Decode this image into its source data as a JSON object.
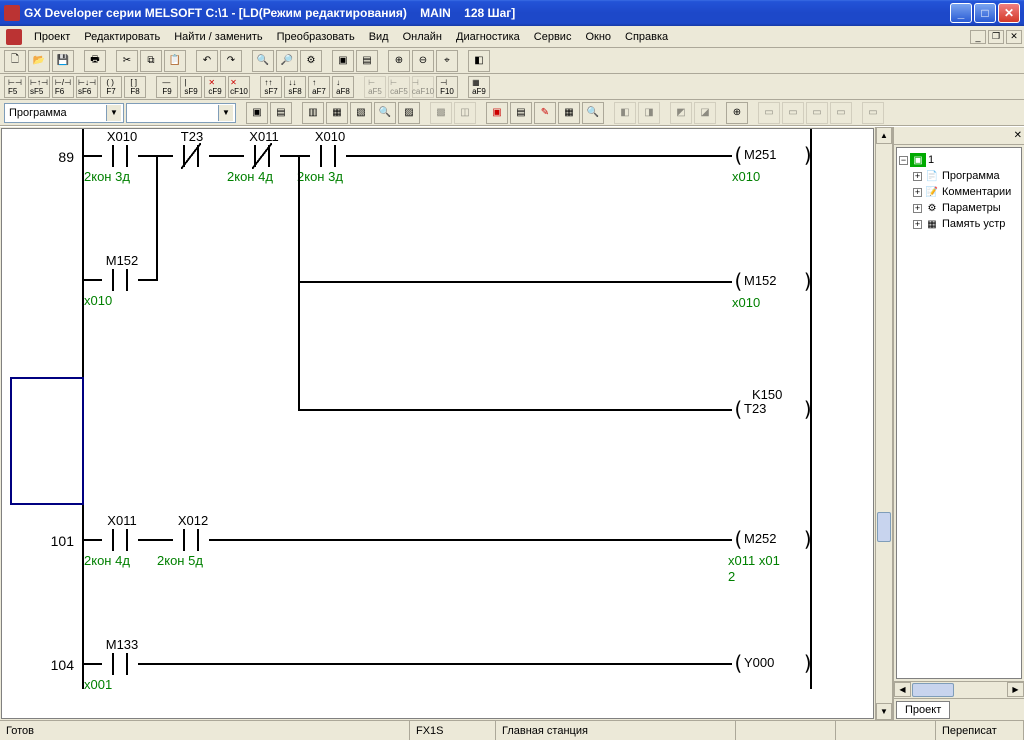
{
  "window": {
    "title": "GX Developer серии MELSOFT C:\\1 - [LD(Режим редактирования)    MAIN    128 Шаг]"
  },
  "menu": {
    "project": "Проект",
    "edit": "Редактировать",
    "find": "Найти / заменить",
    "convert": "Преобразовать",
    "view": "Вид",
    "online": "Онлайн",
    "diagnostics": "Диагностика",
    "service": "Сервис",
    "window_m": "Окно",
    "help": "Справка"
  },
  "shortcut_bar": {
    "f5": "F5",
    "sf5": "sF5",
    "f6": "F6",
    "sf6": "sF6",
    "f7": "F7",
    "f8": "F8",
    "f9": "F9",
    "sf9": "sF9",
    "cf9": "cF9",
    "cf10": "cF10",
    "sf7": "sF7",
    "sf8": "sF8",
    "af7": "aF7",
    "af8": "aF8",
    "af5": "aF5",
    "caf5": "caF5",
    "caf10": "caF10",
    "f10": "F10",
    "af9": "aF9"
  },
  "combo": {
    "program": "Программа"
  },
  "ladder": {
    "step89": "89",
    "step101": "101",
    "step104": "104",
    "X010": "X010",
    "T23": "T23",
    "X011": "X011",
    "X012": "X012",
    "M152": "M152",
    "M133": "M133",
    "M251": "M251",
    "M252": "M252",
    "T23coil": "T23",
    "K150": "K150",
    "Y000": "Y000",
    "c_2k3d": "2кон 3д",
    "c_2k4d": "2кон 4д",
    "c_2k5d": "2кон 5д",
    "c_x010": "x010",
    "c_x001": "x001",
    "c_x011x01": "x011 x01",
    "c_2": "2"
  },
  "tree": {
    "root": "1",
    "program": "Программа",
    "comments": "Комментарии",
    "params": "Параметры",
    "memory": "Память устр"
  },
  "sidetab": {
    "project": "Проект"
  },
  "status": {
    "ready": "Готов",
    "plc": "FX1S",
    "station": "Главная станция",
    "overwrite": "Переписат"
  }
}
